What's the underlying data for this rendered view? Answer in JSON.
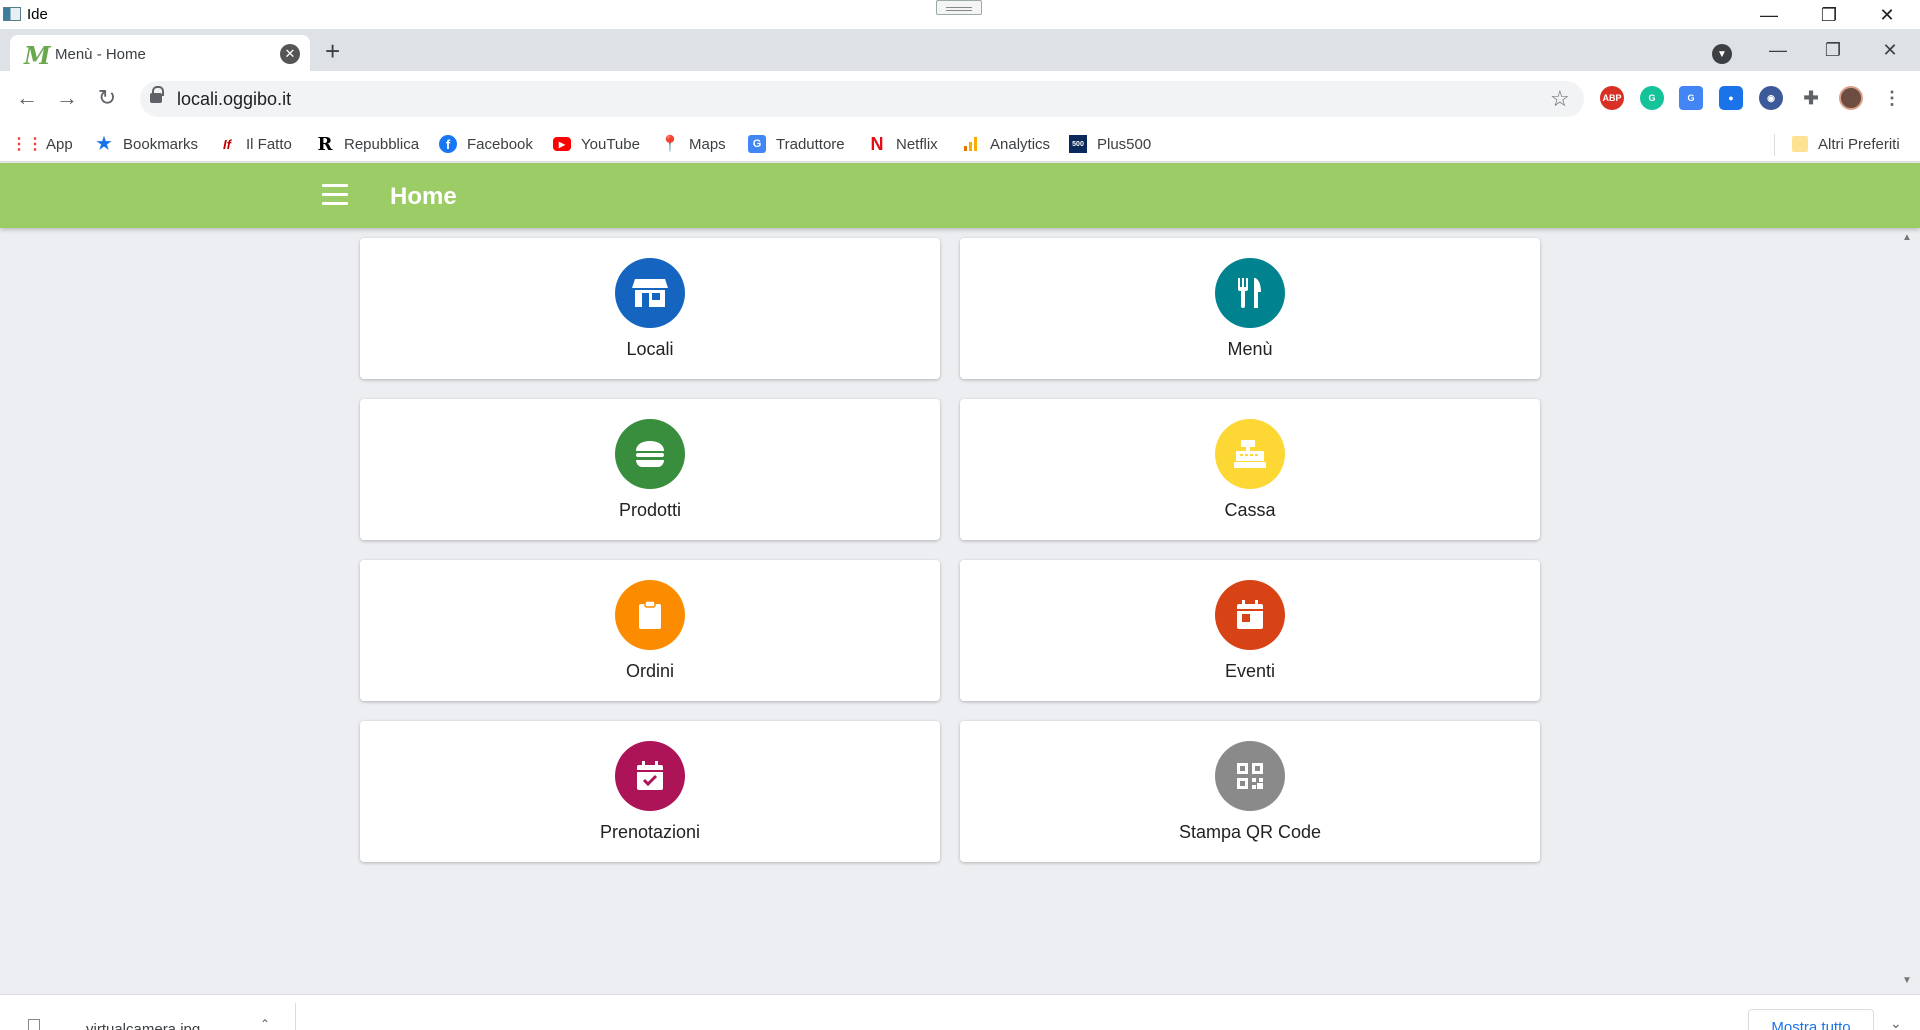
{
  "os": {
    "title": "Ide",
    "minimize": "—",
    "restore": "❐",
    "close": "✕"
  },
  "browser": {
    "tab_title": "Menù - Home",
    "tab_favicon": "M",
    "tab_close": "✕",
    "new_tab": "+",
    "url": "locali.oggibo.it",
    "win_minimize": "—",
    "win_restore": "❐",
    "win_close": "✕"
  },
  "bookmarks": [
    {
      "label": "App",
      "icon": "apps-grid-icon",
      "color": "#e94235"
    },
    {
      "label": "Bookmarks",
      "icon": "star-icon",
      "color": "#1a73e8"
    },
    {
      "label": "Il Fatto",
      "icon": "ilfatto-icon",
      "color": "#c00000"
    },
    {
      "label": "Repubblica",
      "icon": "repubblica-icon",
      "color": "#000000"
    },
    {
      "label": "Facebook",
      "icon": "facebook-icon",
      "color": "#1877f2"
    },
    {
      "label": "YouTube",
      "icon": "youtube-icon",
      "color": "#ff0000"
    },
    {
      "label": "Maps",
      "icon": "maps-pin-icon",
      "color": "#34a853"
    },
    {
      "label": "Traduttore",
      "icon": "translate-icon",
      "color": "#4285f4"
    },
    {
      "label": "Netflix",
      "icon": "netflix-icon",
      "color": "#e50914"
    },
    {
      "label": "Analytics",
      "icon": "analytics-icon",
      "color": "#f9ab00"
    },
    {
      "label": "Plus500",
      "icon": "plus500-icon",
      "color": "#0b2a5b"
    }
  ],
  "other_bookmarks": "Altri Preferiti",
  "app": {
    "title": "Home"
  },
  "tiles": [
    {
      "label": "Locali",
      "icon": "store-icon",
      "color": "#1565c0"
    },
    {
      "label": "Menù",
      "icon": "fork-knife-icon",
      "color": "#00838f"
    },
    {
      "label": "Prodotti",
      "icon": "burger-icon",
      "color": "#388e3c"
    },
    {
      "label": "Cassa",
      "icon": "cash-register-icon",
      "color": "#fdd835"
    },
    {
      "label": "Ordini",
      "icon": "clipboard-icon",
      "color": "#fb8c00"
    },
    {
      "label": "Eventi",
      "icon": "calendar-icon",
      "color": "#d84315"
    },
    {
      "label": "Prenotazioni",
      "icon": "calendar-check-icon",
      "color": "#ad1457"
    },
    {
      "label": "Stampa QR Code",
      "icon": "qr-code-icon",
      "color": "#8a8a8a"
    }
  ],
  "downloads": {
    "file": "virtualcamera.jpg",
    "show_all": "Mostra tutto"
  }
}
